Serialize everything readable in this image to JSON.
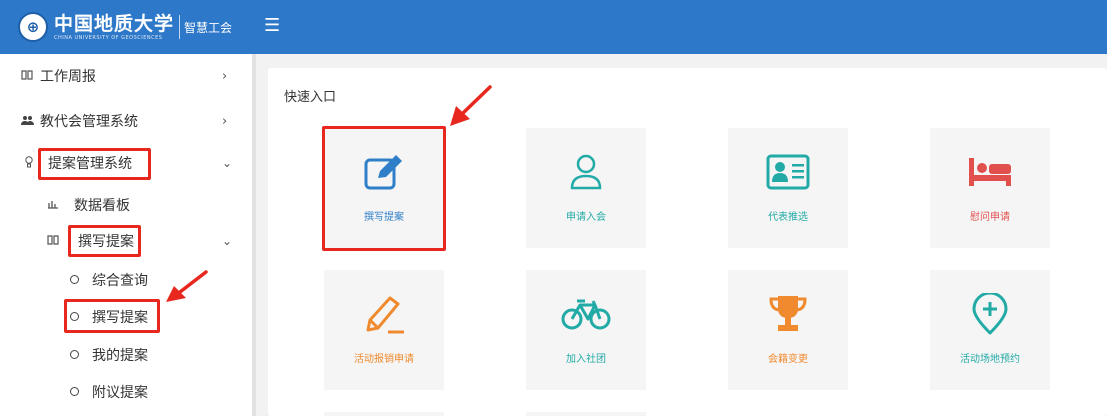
{
  "header": {
    "logo_text": "中国地质大学",
    "logo_en": "CHINA UNIVERSITY OF GEOSCIENCES",
    "app_name": "智慧工会",
    "menu_icon": "hamburger-icon"
  },
  "sidebar": {
    "items": [
      {
        "label": "工作周报",
        "icon": "book-icon"
      },
      {
        "label": "教代会管理系统",
        "icon": "users-icon"
      },
      {
        "label": "提案管理系统",
        "icon": "bulb-icon"
      },
      {
        "label": "数据看板",
        "icon": "bar-chart-icon"
      },
      {
        "label": "撰写提案",
        "icon": "book-icon"
      },
      {
        "label": "综合查询",
        "icon": "circle-icon"
      },
      {
        "label": "撰写提案",
        "icon": "circle-icon"
      },
      {
        "label": "我的提案",
        "icon": "circle-icon"
      },
      {
        "label": "附议提案",
        "icon": "circle-icon"
      }
    ]
  },
  "main": {
    "section_title": "快速入口",
    "tiles": [
      {
        "label": "撰写提案",
        "icon": "edit-icon",
        "color": "#2f7fc8"
      },
      {
        "label": "申请入会",
        "icon": "user-icon",
        "color": "#22aaa6"
      },
      {
        "label": "代表推选",
        "icon": "id-card-icon",
        "color": "#22aaa6"
      },
      {
        "label": "慰问申请",
        "icon": "bed-icon",
        "color": "#e2504e"
      },
      {
        "label": "活动报销申请",
        "icon": "pencil-icon",
        "color": "#ef8a2e"
      },
      {
        "label": "加入社团",
        "icon": "bicycle-icon",
        "color": "#22aaa6"
      },
      {
        "label": "会籍变更",
        "icon": "trophy-icon",
        "color": "#ef8a2e"
      },
      {
        "label": "活动场地预约",
        "icon": "location-plus-icon",
        "color": "#22aaa6"
      }
    ]
  },
  "colors": {
    "header_bg": "#2d78c8",
    "highlight_red": "#e8281f",
    "tile_bg": "#f5f5f5"
  }
}
